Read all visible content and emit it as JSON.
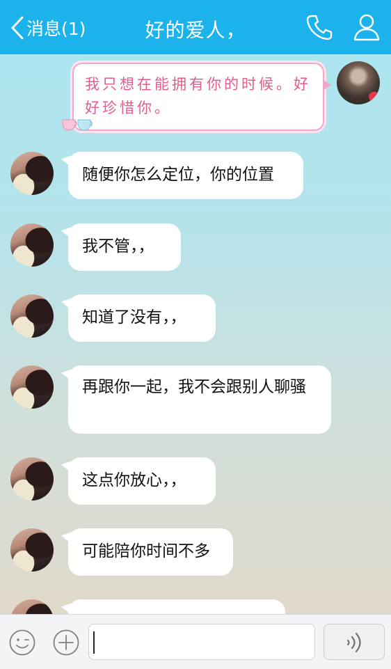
{
  "header": {
    "back_label": "消息(1)",
    "title": "好的爱人，"
  },
  "chat": {
    "sent_message": "我只想在能拥有你的时候。好好珍惜你。",
    "received": [
      {
        "text": "随便你怎么定位，你的位置"
      },
      {
        "text": "我不管，，"
      },
      {
        "text": "知道了没有，，"
      },
      {
        "text": "再跟你一起，我不会跟别人聊骚"
      },
      {
        "text": "这点你放心，，"
      },
      {
        "text": "可能陪你时间不多"
      },
      {
        "text": ""
      }
    ]
  },
  "input": {
    "value": ""
  },
  "colors": {
    "header": "#1cb2ec",
    "sent_text": "#e35c8c",
    "sent_border": "#f0a7c8"
  }
}
